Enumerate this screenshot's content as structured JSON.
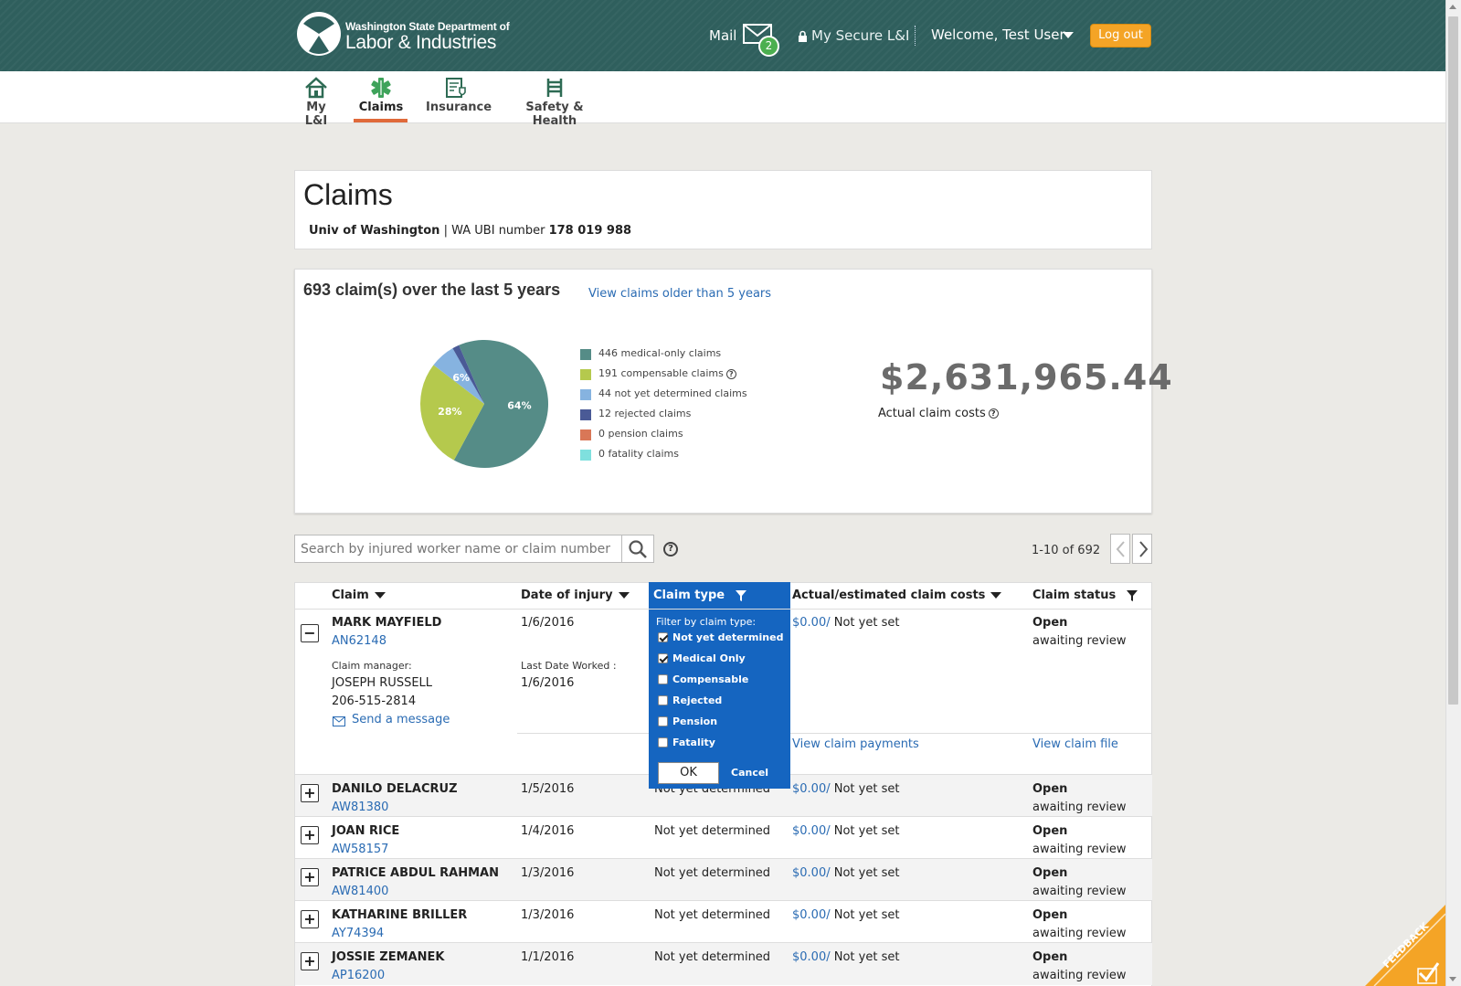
{
  "header": {
    "logo_small": "Washington State Department of",
    "logo_big": "Labor & Industries",
    "mail_label": "Mail",
    "mail_count": "2",
    "secure_label": "My Secure L&I",
    "welcome": "Welcome, Test User",
    "logout": "Log out"
  },
  "nav": {
    "items": [
      {
        "label": "My L&I",
        "icon": "home-icon"
      },
      {
        "label": "Claims",
        "icon": "medical-star-icon",
        "active": true
      },
      {
        "label": "Insurance",
        "icon": "insurance-doc-icon"
      },
      {
        "label": "Safety & Health",
        "icon": "safety-ladder-icon"
      }
    ]
  },
  "page": {
    "title": "Claims",
    "employer": "Univ of Washington",
    "separator": "|",
    "ubi_label": "WA UBI number",
    "ubi_number": "178 019 988"
  },
  "summary": {
    "heading": "693 claim(s) over the last 5 years",
    "older_link": "View claims older than 5 years",
    "total_cost": "$2,631,965.44",
    "total_cost_label": "Actual claim costs"
  },
  "chart_data": {
    "type": "pie",
    "slices": [
      {
        "label": "446 medical-only claims",
        "value": 446,
        "pct_label": "64%",
        "color": "#558c87"
      },
      {
        "label": "191 compensable claims",
        "value": 191,
        "pct_label": "28%",
        "color": "#b5c94d"
      },
      {
        "label": "44 not yet determined claims",
        "value": 44,
        "pct_label": "6%",
        "color": "#86b3e0"
      },
      {
        "label": "12 rejected claims",
        "value": 12,
        "pct_label": "",
        "color": "#4a5a96"
      },
      {
        "label": "0 pension claims",
        "value": 0,
        "pct_label": "",
        "color": "#d97757"
      },
      {
        "label": "0 fatality claims",
        "value": 0,
        "pct_label": "",
        "color": "#7fe0de"
      }
    ]
  },
  "search": {
    "placeholder": "Search by injured worker name or claim number",
    "help": "?"
  },
  "pager": {
    "text": "1-10 of 692"
  },
  "table": {
    "headers": {
      "claim": "Claim",
      "date": "Date of injury",
      "type": "Claim type",
      "costs": "Actual/estimated claim costs",
      "status": "Claim status"
    },
    "expanded": {
      "name": "MARK MAYFIELD",
      "id": "AN62148",
      "date": "1/6/2016",
      "cost": "$0.00/",
      "cost_note": "Not yet set",
      "status": "Open",
      "status_sub": "awaiting review",
      "manager_label": "Claim manager:",
      "manager": "JOSEPH RUSSELL",
      "phone": "206-515-2814",
      "send_message": "Send a message",
      "last_worked_label": "Last Date Worked :",
      "last_worked": "1/6/2016",
      "payments_link": "View claim payments",
      "file_link": "View claim file"
    },
    "rows": [
      {
        "name": "DANILO DELACRUZ",
        "id": "AW81380",
        "date": "1/5/2016",
        "type": "Not yet determined",
        "cost": "$0.00/",
        "cost_note": "Not yet set",
        "status": "Open",
        "status_sub": "awaiting review"
      },
      {
        "name": "JOAN RICE",
        "id": "AW58157",
        "date": "1/4/2016",
        "type": "Not yet determined",
        "cost": "$0.00/",
        "cost_note": "Not yet set",
        "status": "Open",
        "status_sub": "awaiting review"
      },
      {
        "name": "PATRICE ABDUL RAHMAN",
        "id": "AW81400",
        "date": "1/3/2016",
        "type": "Not yet determined",
        "cost": "$0.00/",
        "cost_note": "Not yet set",
        "status": "Open",
        "status_sub": "awaiting review"
      },
      {
        "name": "KATHARINE BRILLER",
        "id": "AY74394",
        "date": "1/3/2016",
        "type": "Not yet determined",
        "cost": "$0.00/",
        "cost_note": "Not yet set",
        "status": "Open",
        "status_sub": "awaiting review"
      },
      {
        "name": "JOSSIE ZEMANEK",
        "id": "AP16200",
        "date": "1/1/2016",
        "type": "Not yet determined",
        "cost": "$0.00/",
        "cost_note": "Not yet set",
        "status": "Open",
        "status_sub": "awaiting review"
      }
    ]
  },
  "filter": {
    "title": "Filter by claim type:",
    "options": [
      {
        "label": "Not yet determined",
        "checked": true
      },
      {
        "label": "Medical Only",
        "checked": true
      },
      {
        "label": "Compensable",
        "checked": false
      },
      {
        "label": "Rejected",
        "checked": false
      },
      {
        "label": "Pension",
        "checked": false
      },
      {
        "label": "Fatality",
        "checked": false
      }
    ],
    "ok": "OK",
    "cancel": "Cancel"
  },
  "feedback": {
    "label": "FEEDBACK",
    "color": "#f4a426"
  }
}
